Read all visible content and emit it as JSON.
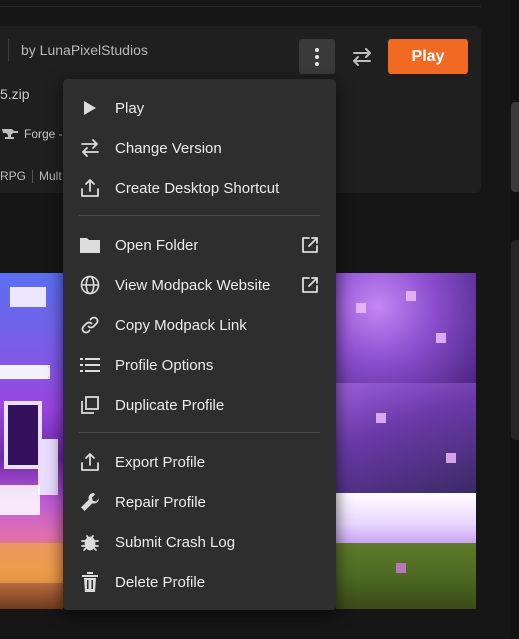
{
  "header": {
    "author": "by LunaPixelStudios",
    "play_label": "Play",
    "file_name": "5.zip",
    "loader": "Forge -",
    "tags": [
      "RPG",
      "Mult"
    ]
  },
  "menu": {
    "items": [
      {
        "label": "Play",
        "icon": "play-icon"
      },
      {
        "label": "Change Version",
        "icon": "swap-arrows-icon"
      },
      {
        "label": "Create Desktop Shortcut",
        "icon": "share-upload-icon"
      },
      {
        "label": "Open Folder",
        "icon": "folder-icon",
        "external": true
      },
      {
        "label": "View Modpack Website",
        "icon": "globe-icon",
        "external": true
      },
      {
        "label": "Copy Modpack Link",
        "icon": "link-icon"
      },
      {
        "label": "Profile Options",
        "icon": "list-icon"
      },
      {
        "label": "Duplicate Profile",
        "icon": "duplicate-icon"
      },
      {
        "label": "Export Profile",
        "icon": "export-icon"
      },
      {
        "label": "Repair Profile",
        "icon": "wrench-icon"
      },
      {
        "label": "Submit Crash Log",
        "icon": "bug-icon"
      },
      {
        "label": "Delete Profile",
        "icon": "trash-icon"
      }
    ]
  },
  "colors": {
    "accent": "#f06a24",
    "menu_bg": "#2e2e2e",
    "page_bg": "#161616"
  }
}
